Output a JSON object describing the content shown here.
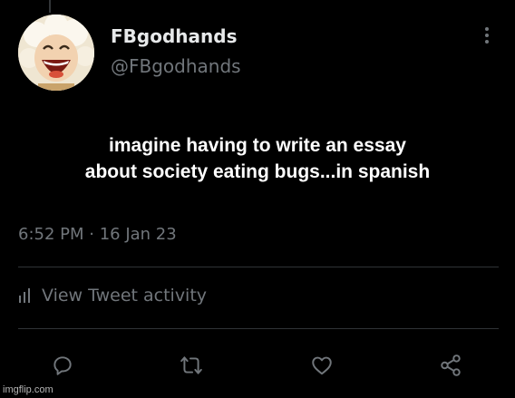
{
  "tweet": {
    "display_name": "FBgodhands",
    "handle": "@FBgodhands",
    "text_line1": "imagine having to write an essay",
    "text_line2": "about society eating bugs...in spanish",
    "timestamp": "6:52 PM · 16 Jan 23"
  },
  "activity": {
    "label": "View Tweet activity",
    "icon": "bar-chart-icon"
  },
  "actions": [
    {
      "name": "reply",
      "icon": "reply-icon"
    },
    {
      "name": "retweet",
      "icon": "retweet-icon"
    },
    {
      "name": "like",
      "icon": "heart-icon"
    },
    {
      "name": "share",
      "icon": "share-icon"
    }
  ],
  "watermark": "imgflip.com",
  "colors": {
    "background": "#000000",
    "primary_text": "#e7e9ea",
    "secondary_text": "#71767b",
    "divider": "#2f3336"
  }
}
